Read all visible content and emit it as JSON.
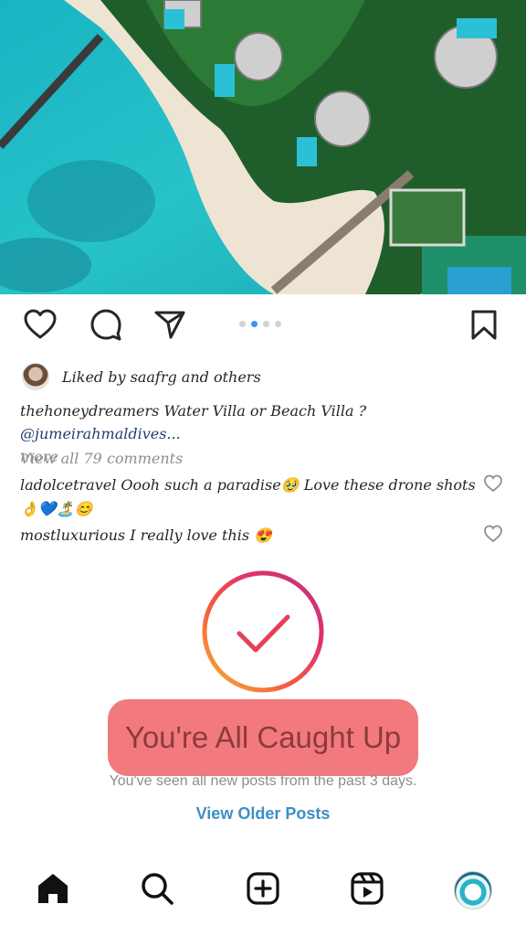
{
  "post": {
    "liked_by": "Liked by saafrg and others",
    "caption_user": "thehoneydreamers",
    "caption_text": " Water Villa or Beach Villa ? ",
    "caption_mention": "@jumeirahmaldives...",
    "caption_more": "more",
    "view_all_comments": "View all 79 comments",
    "carousel": {
      "count": 4,
      "active_index": 1
    }
  },
  "comments": [
    {
      "user": "ladolcetravel",
      "text": " Oooh such a paradise🥹 Love these drone shots 👌💙🏝️😊"
    },
    {
      "user": "mostluxurious",
      "text": " I really love this 😍"
    }
  ],
  "caught_up": {
    "title": "You're All Caught Up",
    "subtitle": "You've seen all new posts from the past 3 days.",
    "view_older": "View Older Posts"
  },
  "icons": {
    "actions": [
      "heart-icon",
      "comment-icon",
      "share-icon",
      "bookmark-icon"
    ],
    "nav": [
      "home-icon",
      "search-icon",
      "new-post-icon",
      "reels-icon",
      "profile-avatar"
    ]
  },
  "colors": {
    "link": "#3d8fc7",
    "highlight": "#f16f73",
    "carousel_active": "#3897f0",
    "muted": "#8e8e8e"
  }
}
